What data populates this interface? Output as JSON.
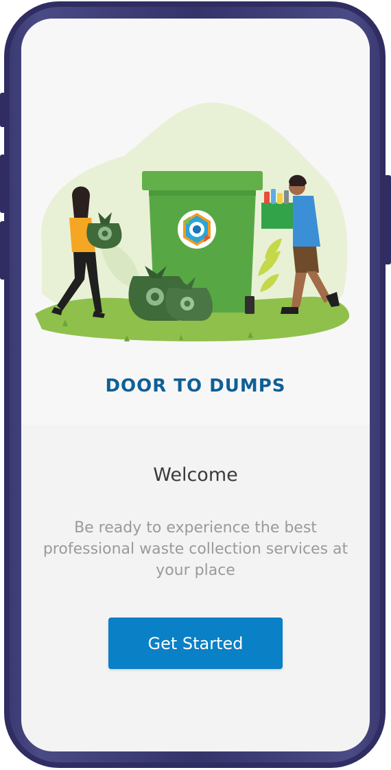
{
  "app": {
    "brand_name": "DOOR TO DUMPS"
  },
  "welcome": {
    "title": "Welcome",
    "description": "Be ready to experience the best professional waste collection services at your place"
  },
  "actions": {
    "get_started_label": "Get Started"
  },
  "illustration": {
    "name": "waste-collection-illustration",
    "logo_icon": "door-to-dumps-logo-icon",
    "recycle_icon": "recycle-icon"
  },
  "colors": {
    "brand_blue": "#0f5f96",
    "button_blue": "#0a80c6",
    "bin_green": "#57a845",
    "phone_frame": "#2f2d62",
    "background": "#f3f3f3"
  }
}
